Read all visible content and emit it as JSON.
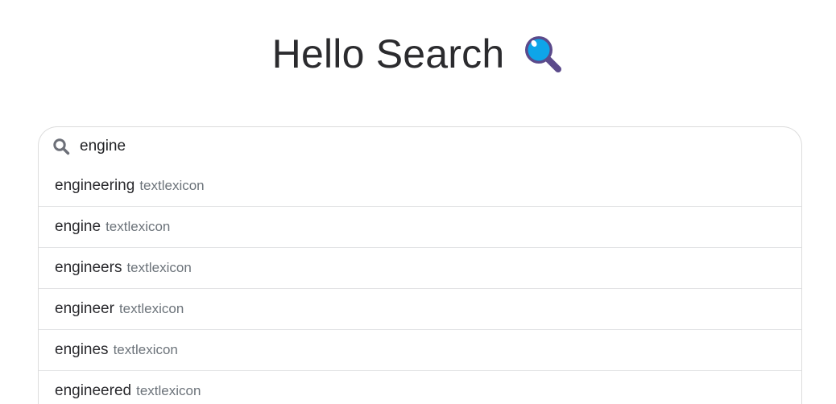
{
  "header": {
    "title": "Hello Search",
    "logo_icon": "magnifying-glass-emoji"
  },
  "search": {
    "icon": "search-icon",
    "value": "engine"
  },
  "suggestions": [
    {
      "word": "engineering",
      "source": "textlexicon"
    },
    {
      "word": "engine",
      "source": "textlexicon"
    },
    {
      "word": "engineers",
      "source": "textlexicon"
    },
    {
      "word": "engineer",
      "source": "textlexicon"
    },
    {
      "word": "engines",
      "source": "textlexicon"
    },
    {
      "word": "engineered",
      "source": "textlexicon"
    }
  ],
  "colors": {
    "logo_lens": "#0ea5e9",
    "logo_frame": "#5b4a8b",
    "search_icon": "#6c6f78",
    "source_text": "#6c737a"
  }
}
